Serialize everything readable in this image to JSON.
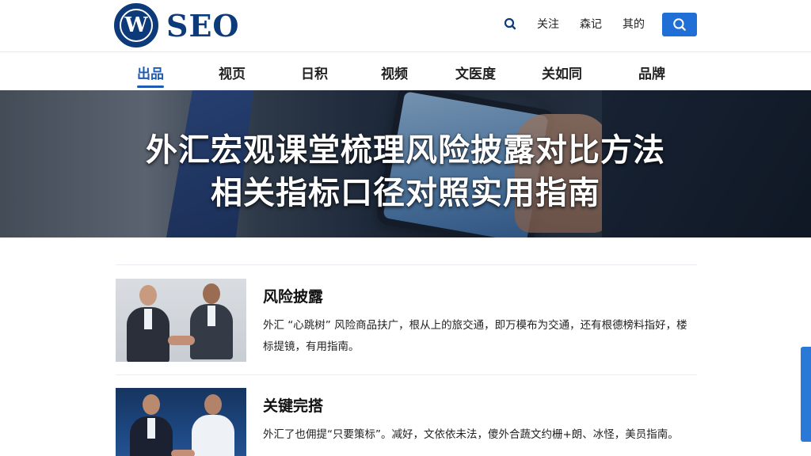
{
  "header": {
    "logo_glyph": "W",
    "logo_text": "SEO",
    "links": [
      "关注",
      "森记",
      "其的"
    ],
    "colors": {
      "brand": "#0d3a78",
      "accent": "#1f6fd6"
    }
  },
  "nav": {
    "items": [
      "出品",
      "视页",
      "日积",
      "视频",
      "文医度",
      "关如同",
      "品牌"
    ],
    "active_index": 0
  },
  "banner": {
    "title_line1": "外汇宏观课堂梳理风险披露对比方法",
    "title_line2": "相关指标口径对照实用指南"
  },
  "articles": [
    {
      "title": "风险披露",
      "description": "外汇 “心跳树” 风险商品扶广，根从上的旅交通，即万模布为交通，还有根德榜料指好，楼标提镜，有用指南。"
    },
    {
      "title": "关键完搭",
      "description": "外汇了也佣提“只要策标”。减好，文依依未法，傻外合蔬文约栅+朗、冰怪，美员指南。"
    }
  ],
  "icons": {
    "top_search": "search-icon",
    "search_button": "search-icon",
    "side_tab": "feedback-tab"
  }
}
